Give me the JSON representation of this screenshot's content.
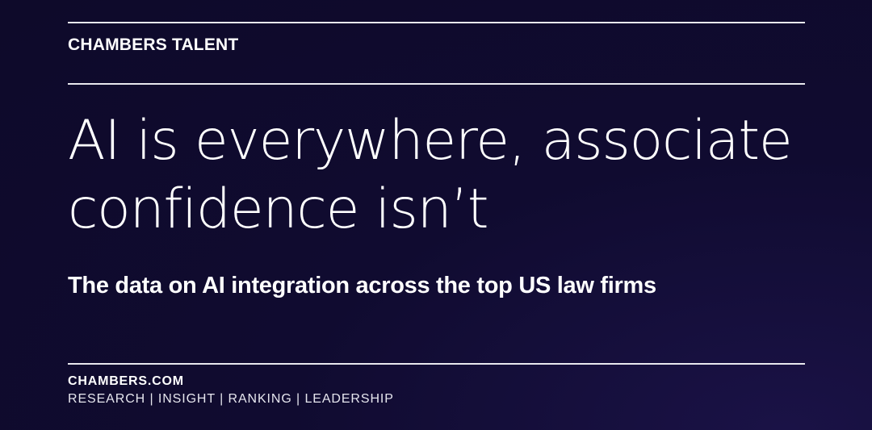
{
  "header": {
    "brand": "CHAMBERS TALENT"
  },
  "main": {
    "headline_line1": "AI is everywhere, associate",
    "headline_line2": "confidence isn’t",
    "subheading": "The data on AI integration across the top US law firms"
  },
  "footer": {
    "site": "CHAMBERS.COM",
    "tagline": "RESEARCH | INSIGHT | RANKING | LEADERSHIP"
  },
  "colors": {
    "background": "#100b30",
    "text": "#ffffff",
    "rule": "#e8e8ee"
  }
}
